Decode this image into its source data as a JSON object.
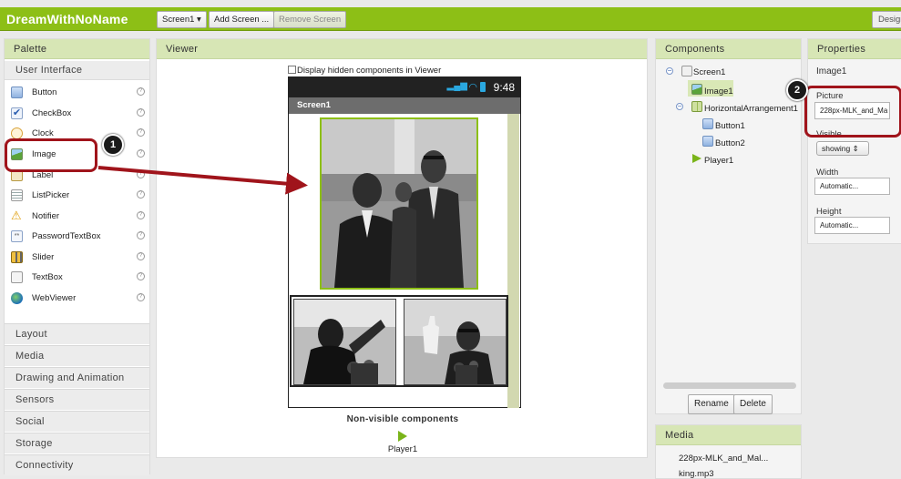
{
  "app": {
    "title": "DreamWithNoName"
  },
  "toolbar": {
    "screen_select": "Screen1 ▾",
    "add_screen": "Add Screen ...",
    "remove_screen": "Remove Screen",
    "designer": "Designer"
  },
  "palette": {
    "title": "Palette",
    "section": "User Interface",
    "items": [
      {
        "label": "Button",
        "icon": "button-icon"
      },
      {
        "label": "CheckBox",
        "icon": "checkbox-icon"
      },
      {
        "label": "Clock",
        "icon": "clock-icon"
      },
      {
        "label": "Image",
        "icon": "image-icon"
      },
      {
        "label": "Label",
        "icon": "label-icon"
      },
      {
        "label": "ListPicker",
        "icon": "listpicker-icon"
      },
      {
        "label": "Notifier",
        "icon": "notifier-icon"
      },
      {
        "label": "PasswordTextBox",
        "icon": "password-icon"
      },
      {
        "label": "Slider",
        "icon": "slider-icon"
      },
      {
        "label": "TextBox",
        "icon": "textbox-icon"
      },
      {
        "label": "WebViewer",
        "icon": "webviewer-icon"
      }
    ],
    "categories": [
      "Layout",
      "Media",
      "Drawing and Animation",
      "Sensors",
      "Social",
      "Storage",
      "Connectivity"
    ]
  },
  "viewer": {
    "title": "Viewer",
    "hidden_checkbox": "Display hidden components in Viewer",
    "time": "9:48",
    "screen_title": "Screen1",
    "nonvisible_title": "Non-visible components",
    "nonvisible_item": "Player1"
  },
  "components": {
    "title": "Components",
    "tree": [
      "Screen1",
      "Image1",
      "HorizontalArrangement1",
      "Button1",
      "Button2",
      "Player1"
    ],
    "rename": "Rename",
    "delete": "Delete"
  },
  "media": {
    "title": "Media",
    "items": [
      "228px-MLK_and_Mal...",
      "king.mp3"
    ]
  },
  "properties": {
    "title": "Properties",
    "component": "Image1",
    "picture_label": "Picture",
    "picture_value": "228px-MLK_and_Ma",
    "visible_label": "Visible",
    "visible_value": "showing",
    "width_label": "Width",
    "width_value": "Automatic...",
    "height_label": "Height",
    "height_value": "Automatic..."
  },
  "annotations": {
    "badge1": "1",
    "badge2": "2"
  },
  "colors": {
    "accent": "#8dbf16",
    "callout": "#a0141b",
    "panel_header": "#d7e6b5"
  }
}
